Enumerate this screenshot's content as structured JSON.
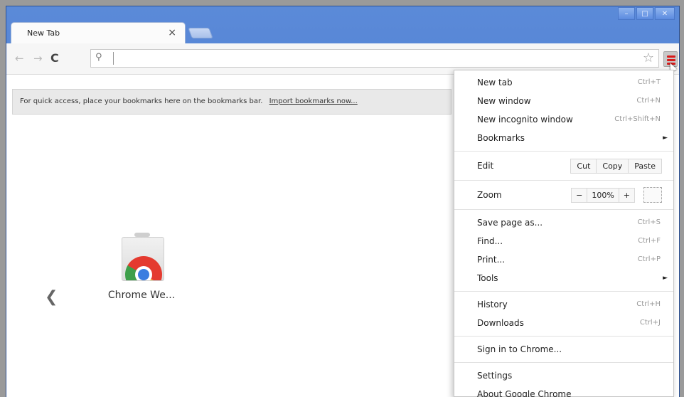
{
  "window": {
    "controls": {
      "minimize": "–",
      "maximize": "□",
      "close": "✕"
    }
  },
  "tab": {
    "title": "New Tab",
    "close": "×"
  },
  "toolbar": {
    "back_icon": "←",
    "forward_icon": "→",
    "reload_icon": "C",
    "search_icon": "⚲",
    "omnibox_value": "",
    "star_icon": "☆"
  },
  "bookmark_bar": {
    "message": "For quick access, place your bookmarks here on the bookmarks bar.",
    "import_link": "Import bookmarks now..."
  },
  "apps": [
    {
      "label": "Chrome We..."
    }
  ],
  "prev_arrow": "❮",
  "menu": {
    "new_tab": {
      "label": "New tab",
      "shortcut": "Ctrl+T"
    },
    "new_window": {
      "label": "New window",
      "shortcut": "Ctrl+N"
    },
    "new_incognito": {
      "label": "New incognito window",
      "shortcut": "Ctrl+Shift+N"
    },
    "bookmarks": {
      "label": "Bookmarks",
      "arrow": "►"
    },
    "edit": {
      "label": "Edit",
      "cut": "Cut",
      "copy": "Copy",
      "paste": "Paste"
    },
    "zoom": {
      "label": "Zoom",
      "minus": "−",
      "value": "100%",
      "plus": "+"
    },
    "save_page": {
      "label": "Save page as...",
      "shortcut": "Ctrl+S"
    },
    "find": {
      "label": "Find...",
      "shortcut": "Ctrl+F"
    },
    "print": {
      "label": "Print...",
      "shortcut": "Ctrl+P"
    },
    "tools": {
      "label": "Tools",
      "arrow": "►"
    },
    "history": {
      "label": "History",
      "shortcut": "Ctrl+H"
    },
    "downloads": {
      "label": "Downloads",
      "shortcut": "Ctrl+J"
    },
    "sign_in": {
      "label": "Sign in to Chrome..."
    },
    "settings": {
      "label": "Settings"
    },
    "about": {
      "label": "About Google Chrome"
    }
  }
}
